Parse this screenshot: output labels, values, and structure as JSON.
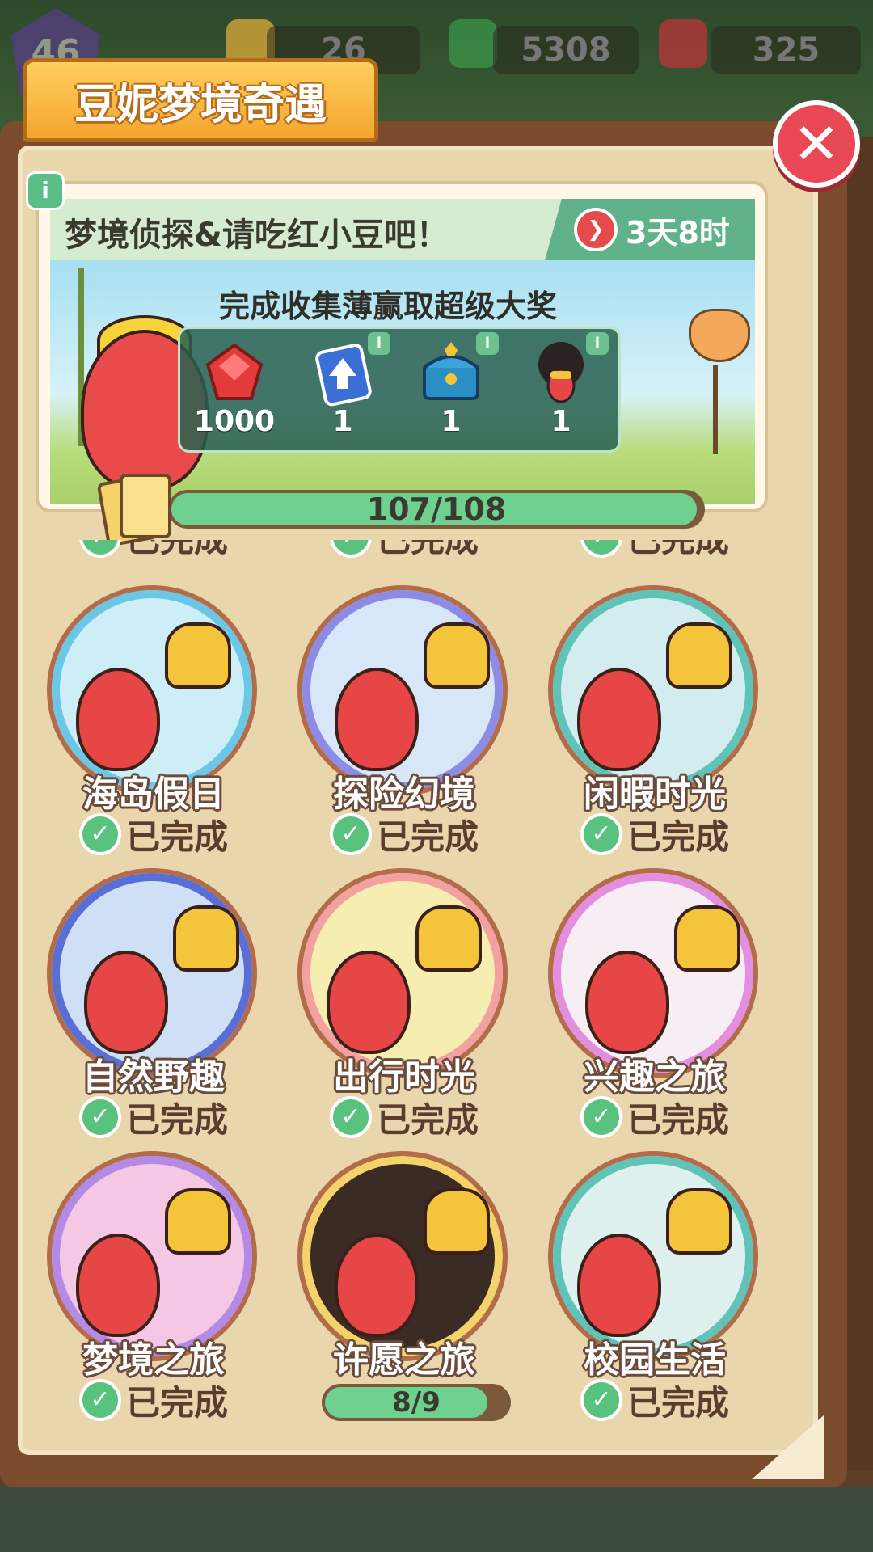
{
  "hud": {
    "level": "46",
    "energy": "26",
    "cash": "5308",
    "gems": "325"
  },
  "title": "豆妮梦境奇遇",
  "close_symbol": "✕",
  "info_symbol": "i",
  "banner": {
    "heading": "梦境侦探&请吃红小豆吧！",
    "timer": "3天8时",
    "subtitle": "完成收集薄赢取超级大奖",
    "rewards": [
      {
        "icon": "ruby-gem-icon",
        "count": "1000",
        "color": "#e33a3a"
      },
      {
        "icon": "upgrade-card-icon",
        "count": "1",
        "color": "#3b6fd6"
      },
      {
        "icon": "treasure-chest-icon",
        "count": "1",
        "color": "#2a8fc4"
      },
      {
        "icon": "character-avatar-icon",
        "count": "1",
        "color": "#2b2222"
      }
    ]
  },
  "progress": {
    "text": "107/108",
    "fraction": 0.9907
  },
  "albums": [
    {
      "name": "海岛假日",
      "status": "已完成",
      "ring": "#6cc7e6",
      "bg": "#cdeef7"
    },
    {
      "name": "探险幻境",
      "status": "已完成",
      "ring": "#8c8ce6",
      "bg": "#d7e7f8"
    },
    {
      "name": "闲暇时光",
      "status": "已完成",
      "ring": "#5fc3b8",
      "bg": "#d2ecef"
    },
    {
      "name": "自然野趣",
      "status": "已完成",
      "ring": "#5a6fd6",
      "bg": "#cfe0f6"
    },
    {
      "name": "出行时光",
      "status": "已完成",
      "ring": "#f2a0a0",
      "bg": "#f5eeb0"
    },
    {
      "name": "兴趣之旅",
      "status": "已完成",
      "ring": "#e48ee0",
      "bg": "#f6eef2"
    },
    {
      "name": "梦境之旅",
      "status": "已完成",
      "ring": "#b48ae6",
      "bg": "#f4c8e4"
    },
    {
      "name": "许愿之旅",
      "status": "",
      "progress": "8/9",
      "fraction": 0.889,
      "ring": "#f4d46a",
      "bg": "#3b2b25"
    },
    {
      "name": "校园生活",
      "status": "已完成",
      "ring": "#5fc3b8",
      "bg": "#dff1ee"
    }
  ],
  "peek_status": "已完成"
}
